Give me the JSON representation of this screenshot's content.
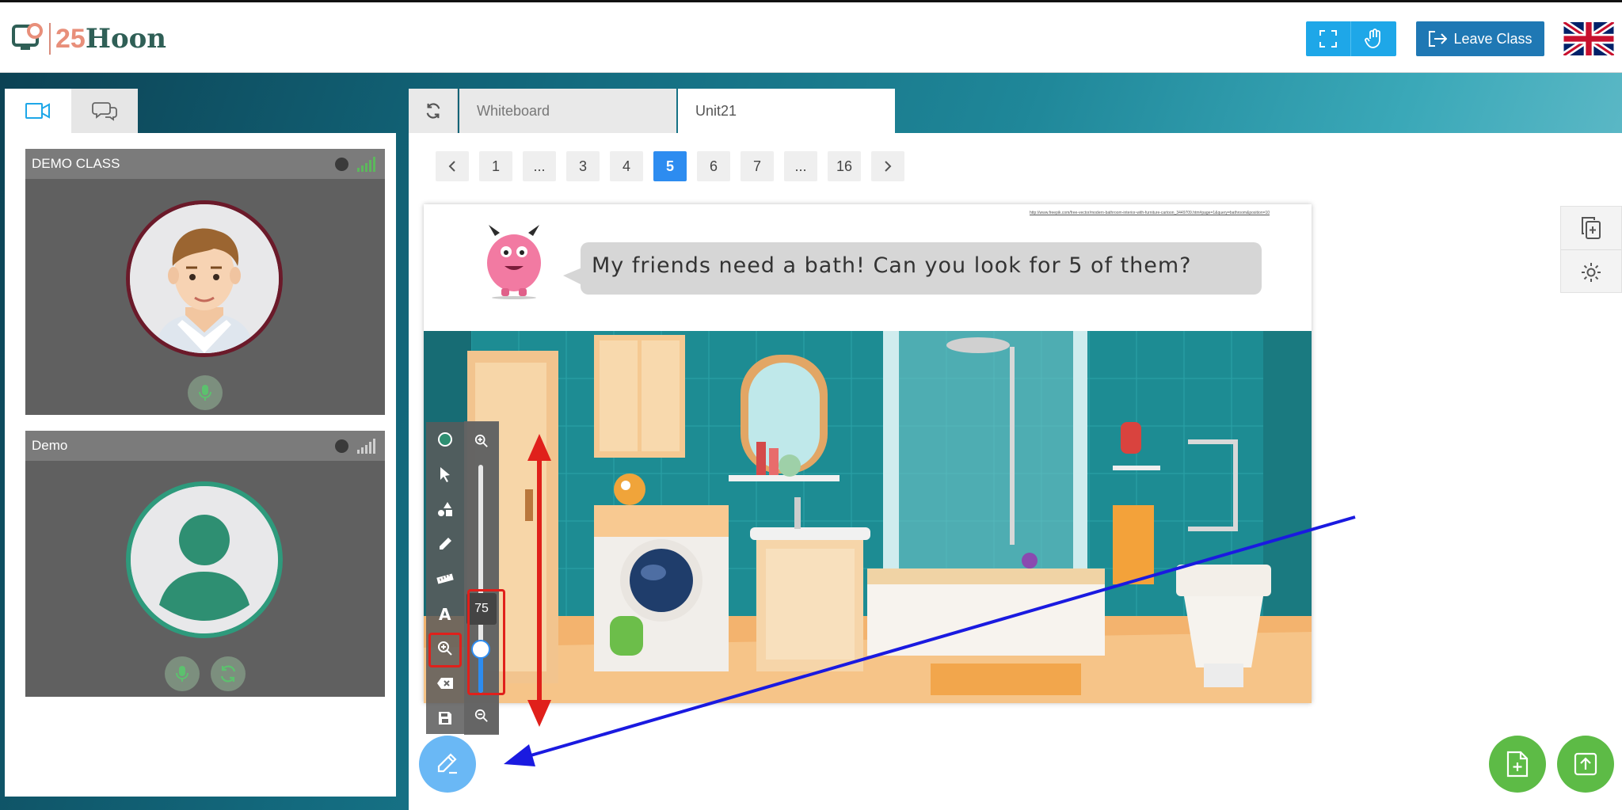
{
  "header": {
    "logo_number": "25",
    "logo_name": "Hoon",
    "fullscreen_icon": "fullscreen-icon",
    "raise_hand_icon": "hand-icon",
    "leave_label": "Leave Class",
    "language_icon": "uk-flag-icon"
  },
  "left_panel": {
    "tabs": [
      {
        "icon": "video-camera-icon"
      },
      {
        "icon": "chat-bubbles-icon"
      }
    ],
    "cards": [
      {
        "name": "DEMO CLASS",
        "avatar": "teacher-avatar"
      },
      {
        "name": "Demo",
        "avatar": "default-user-avatar"
      }
    ]
  },
  "main": {
    "tabs": [
      {
        "label": "Whiteboard"
      },
      {
        "label": "Unit21"
      }
    ],
    "pager": {
      "prev": "chevron-left-icon",
      "items": [
        "1",
        "...",
        "3",
        "4",
        "5",
        "6",
        "7",
        "...",
        "16"
      ],
      "current": "5",
      "next": "chevron-right-icon"
    },
    "slide": {
      "source_url": "http://www.freepik.com/free-vector/modern-bathroom-interior-with-furniture-cartoon_3449709.htm#page=1&query=bathroom&position=10",
      "speech": "My friends need a bath! Can you look for 5 of them?"
    }
  },
  "toolbar": {
    "tools": [
      "circle-icon",
      "pointer-icon",
      "shapes-icon",
      "pencil-icon",
      "ruler-icon",
      "text-icon",
      "zoom-icon",
      "eraser-icon",
      "save-icon"
    ],
    "zoom_value": "75",
    "zoom_level": 75
  },
  "colors": {
    "brand_blue": "#1f78b4",
    "accent_blue": "#2d8cf0",
    "fab_green": "#5dbb46",
    "annotation_red": "#e0201b",
    "annotation_blue": "#1a1ae0"
  }
}
